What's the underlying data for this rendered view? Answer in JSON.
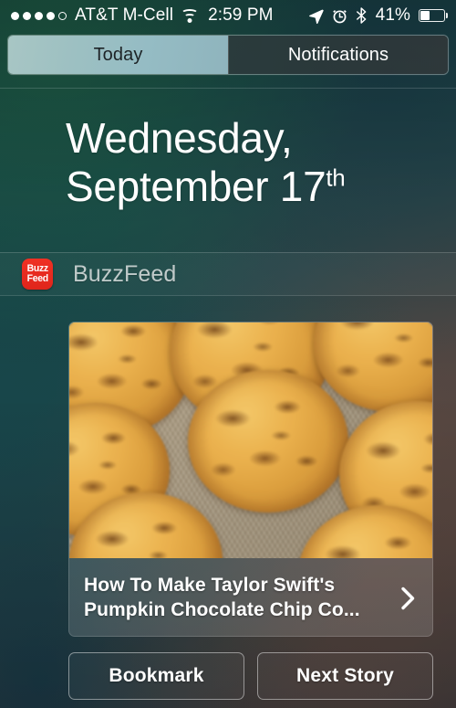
{
  "status_bar": {
    "signal_dots_total": 5,
    "signal_dots_filled": 4,
    "carrier": "AT&T M-Cell",
    "wifi_icon": "wifi-icon",
    "time": "2:59 PM",
    "location_icon": "location-arrow-icon",
    "alarm_icon": "alarm-clock-icon",
    "bluetooth_icon": "bluetooth-icon",
    "battery_percent_label": "41%",
    "battery_level": 41,
    "battery_icon": "battery-icon"
  },
  "segmented_control": {
    "tabs": [
      {
        "label": "Today",
        "selected": true
      },
      {
        "label": "Notifications",
        "selected": false
      }
    ],
    "selected_text_color": "#1d2326",
    "unselected_text_color": "#ffffff"
  },
  "date": {
    "line1": "Wednesday,",
    "line2_month_day": "September 17",
    "ordinal_suffix": "th"
  },
  "widget": {
    "app_icon_line1": "Buzz",
    "app_icon_line2": "Feed",
    "app_icon_color": "#ef3124",
    "name": "BuzzFeed",
    "story": {
      "headline": "How To Make Taylor Swift's Pumpkin Chocolate Chip Co...",
      "chevron_icon": "chevron-right-icon",
      "image_description": "chocolate-chip-cookies-on-baking-sheet"
    },
    "actions": [
      {
        "label": "Bookmark"
      },
      {
        "label": "Next Story"
      }
    ]
  }
}
